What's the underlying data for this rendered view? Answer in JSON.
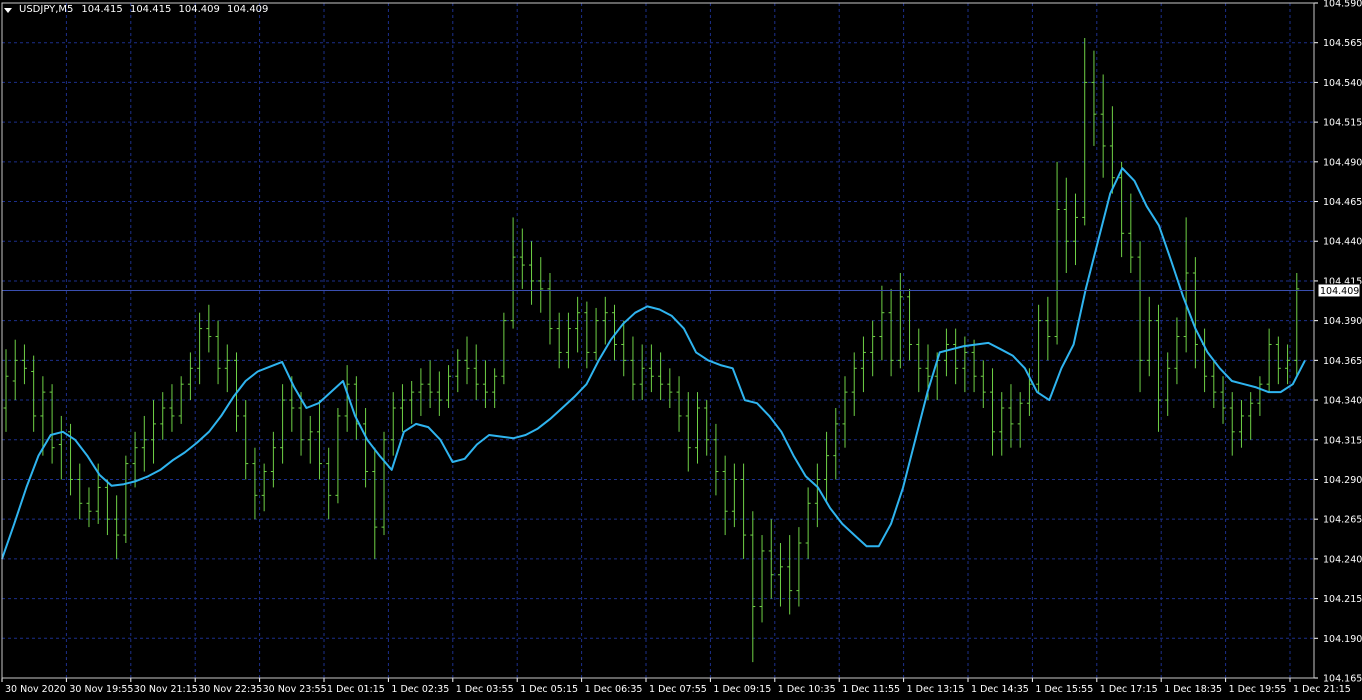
{
  "header": {
    "symbol_label": "USDJPY,M5",
    "ohlc": [
      "104.415",
      "104.415",
      "104.409",
      "104.409"
    ]
  },
  "colors": {
    "background": "#000000",
    "grid": "#1c2f8c",
    "bars": "#6fd146",
    "moving_average": "#2fb4ef",
    "axis_text": "#ffffff"
  },
  "chart_data": {
    "type": "line",
    "series": [
      {
        "name": "",
        "kind": "ohlc-bars",
        "values": [
          [
            104.335,
            104.372,
            104.32,
            104.355
          ],
          [
            104.352,
            104.378,
            104.34,
            104.365
          ],
          [
            104.365,
            104.375,
            104.35,
            104.36
          ],
          [
            104.358,
            104.368,
            104.32,
            104.33
          ],
          [
            104.33,
            104.355,
            104.305,
            104.345
          ],
          [
            104.345,
            104.35,
            104.3,
            104.31
          ],
          [
            104.312,
            104.33,
            104.29,
            104.32
          ],
          [
            104.32,
            104.325,
            104.28,
            104.29
          ],
          [
            104.29,
            104.3,
            104.265,
            104.275
          ],
          [
            104.275,
            104.285,
            104.26,
            104.27
          ],
          [
            104.27,
            104.3,
            104.262,
            104.285
          ],
          [
            104.285,
            104.29,
            104.255,
            104.265
          ],
          [
            104.265,
            104.28,
            104.24,
            104.255
          ],
          [
            104.255,
            104.305,
            104.25,
            104.3
          ],
          [
            104.3,
            104.32,
            104.285,
            104.31
          ],
          [
            104.31,
            104.33,
            104.295,
            104.315
          ],
          [
            104.315,
            104.34,
            104.3,
            104.325
          ],
          [
            104.325,
            104.345,
            104.315,
            104.335
          ],
          [
            104.335,
            104.35,
            104.32,
            104.33
          ],
          [
            104.33,
            104.355,
            104.325,
            104.35
          ],
          [
            104.35,
            104.37,
            104.34,
            104.36
          ],
          [
            104.36,
            104.395,
            104.35,
            104.385
          ],
          [
            104.385,
            104.4,
            104.37,
            104.38
          ],
          [
            104.38,
            104.39,
            104.35,
            104.36
          ],
          [
            104.36,
            104.375,
            104.345,
            104.365
          ],
          [
            104.365,
            104.37,
            104.32,
            104.33
          ],
          [
            104.33,
            104.34,
            104.29,
            104.3
          ],
          [
            104.3,
            104.31,
            104.265,
            104.28
          ],
          [
            104.28,
            104.3,
            104.27,
            104.295
          ],
          [
            104.295,
            104.32,
            104.285,
            104.31
          ],
          [
            104.31,
            104.35,
            104.3,
            104.34
          ],
          [
            104.34,
            104.355,
            104.32,
            104.335
          ],
          [
            104.335,
            104.345,
            104.305,
            104.315
          ],
          [
            104.315,
            104.33,
            104.3,
            104.32
          ],
          [
            104.32,
            104.34,
            104.29,
            104.3
          ],
          [
            104.3,
            104.31,
            104.265,
            104.28
          ],
          [
            104.28,
            104.335,
            104.275,
            104.33
          ],
          [
            104.33,
            104.362,
            104.32,
            104.35
          ],
          [
            104.35,
            104.355,
            104.315,
            104.325
          ],
          [
            104.325,
            104.335,
            104.285,
            104.295
          ],
          [
            104.295,
            104.31,
            104.24,
            104.26
          ],
          [
            104.26,
            104.32,
            104.255,
            104.315
          ],
          [
            104.315,
            104.345,
            104.305,
            104.335
          ],
          [
            104.335,
            104.35,
            104.32,
            104.34
          ],
          [
            104.34,
            104.352,
            104.325,
            104.345
          ],
          [
            104.345,
            104.36,
            104.33,
            104.35
          ],
          [
            104.35,
            104.365,
            104.335,
            104.345
          ],
          [
            104.345,
            104.358,
            104.33,
            104.34
          ],
          [
            104.34,
            104.362,
            104.335,
            104.355
          ],
          [
            104.355,
            104.372,
            104.345,
            104.365
          ],
          [
            104.365,
            104.38,
            104.35,
            104.36
          ],
          [
            104.36,
            104.375,
            104.34,
            104.35
          ],
          [
            104.35,
            104.365,
            104.335,
            104.345
          ],
          [
            104.345,
            104.36,
            104.335,
            104.355
          ],
          [
            104.355,
            104.395,
            104.35,
            104.39
          ],
          [
            104.39,
            104.455,
            104.385,
            104.43
          ],
          [
            104.43,
            104.448,
            104.41,
            104.425
          ],
          [
            104.425,
            104.44,
            104.4,
            104.415
          ],
          [
            104.415,
            104.43,
            104.395,
            104.41
          ],
          [
            104.41,
            104.42,
            104.375,
            104.385
          ],
          [
            104.385,
            104.395,
            104.36,
            104.37
          ],
          [
            104.37,
            104.395,
            104.36,
            104.385
          ],
          [
            104.385,
            104.405,
            104.37,
            104.395
          ],
          [
            104.395,
            104.402,
            104.36,
            104.37
          ],
          [
            104.37,
            104.398,
            104.365,
            104.39
          ],
          [
            104.39,
            104.405,
            104.375,
            104.395
          ],
          [
            104.395,
            104.4,
            104.365,
            104.375
          ],
          [
            104.375,
            104.39,
            104.355,
            104.365
          ],
          [
            104.365,
            104.38,
            104.34,
            104.35
          ],
          [
            104.35,
            104.375,
            104.34,
            104.36
          ],
          [
            104.36,
            104.375,
            104.345,
            104.355
          ],
          [
            104.355,
            104.37,
            104.34,
            104.35
          ],
          [
            104.35,
            104.36,
            104.335,
            104.345
          ],
          [
            104.345,
            104.355,
            104.32,
            104.33
          ],
          [
            104.33,
            104.345,
            104.295,
            104.31
          ],
          [
            104.31,
            104.345,
            104.3,
            104.335
          ],
          [
            104.335,
            104.34,
            104.305,
            104.315
          ],
          [
            104.315,
            104.325,
            104.28,
            104.295
          ],
          [
            104.295,
            104.305,
            104.255,
            104.27
          ],
          [
            104.27,
            104.3,
            104.26,
            104.29
          ],
          [
            104.29,
            104.3,
            104.24,
            104.255
          ],
          [
            104.255,
            104.27,
            104.175,
            104.21
          ],
          [
            104.21,
            104.255,
            104.2,
            104.245
          ],
          [
            104.245,
            104.265,
            104.215,
            104.23
          ],
          [
            104.23,
            104.25,
            104.21,
            104.235
          ],
          [
            104.235,
            104.255,
            104.205,
            104.22
          ],
          [
            104.22,
            104.26,
            104.21,
            104.25
          ],
          [
            104.25,
            104.285,
            104.24,
            104.275
          ],
          [
            104.275,
            104.3,
            104.26,
            104.29
          ],
          [
            104.29,
            104.32,
            104.275,
            104.305
          ],
          [
            104.305,
            104.335,
            104.29,
            104.325
          ],
          [
            104.325,
            104.355,
            104.31,
            104.345
          ],
          [
            104.345,
            104.37,
            104.33,
            104.36
          ],
          [
            104.36,
            104.38,
            104.345,
            104.37
          ],
          [
            104.37,
            104.39,
            104.355,
            104.38
          ],
          [
            104.38,
            104.412,
            104.365,
            104.395
          ],
          [
            104.395,
            104.41,
            104.355,
            104.365
          ],
          [
            104.365,
            104.42,
            104.36,
            104.405
          ],
          [
            104.405,
            104.41,
            104.365,
            104.375
          ],
          [
            104.375,
            104.385,
            104.345,
            104.36
          ],
          [
            104.36,
            104.375,
            104.34,
            104.355
          ],
          [
            104.355,
            104.37,
            104.34,
            104.365
          ],
          [
            104.365,
            104.385,
            104.355,
            104.375
          ],
          [
            104.375,
            104.385,
            104.35,
            104.36
          ],
          [
            104.36,
            104.38,
            104.345,
            104.37
          ],
          [
            104.37,
            104.378,
            104.345,
            104.355
          ],
          [
            104.355,
            104.365,
            104.335,
            104.345
          ],
          [
            104.345,
            104.36,
            104.305,
            104.32
          ],
          [
            104.32,
            104.345,
            104.305,
            104.335
          ],
          [
            104.335,
            104.35,
            104.31,
            104.325
          ],
          [
            104.325,
            104.345,
            104.31,
            104.338
          ],
          [
            104.338,
            104.36,
            104.33,
            104.35
          ],
          [
            104.35,
            104.4,
            104.345,
            104.39
          ],
          [
            104.39,
            104.405,
            104.365,
            104.38
          ],
          [
            104.38,
            104.49,
            104.375,
            104.46
          ],
          [
            104.46,
            104.48,
            104.42,
            104.44
          ],
          [
            104.44,
            104.47,
            104.425,
            104.455
          ],
          [
            104.455,
            104.568,
            104.45,
            104.54
          ],
          [
            104.54,
            104.56,
            104.5,
            104.52
          ],
          [
            104.52,
            104.545,
            104.48,
            104.5
          ],
          [
            104.5,
            104.525,
            104.47,
            104.48
          ],
          [
            104.48,
            104.49,
            104.43,
            104.445
          ],
          [
            104.445,
            104.47,
            104.42,
            104.43
          ],
          [
            104.43,
            104.44,
            104.345,
            104.365
          ],
          [
            104.365,
            104.405,
            104.355,
            104.39
          ],
          [
            104.39,
            104.4,
            104.32,
            104.34
          ],
          [
            104.34,
            104.37,
            104.33,
            104.36
          ],
          [
            104.36,
            104.392,
            104.35,
            104.38
          ],
          [
            104.38,
            104.455,
            104.37,
            104.42
          ],
          [
            104.42,
            104.43,
            104.36,
            104.375
          ],
          [
            104.375,
            104.385,
            104.345,
            104.355
          ],
          [
            104.355,
            104.365,
            104.335,
            104.345
          ],
          [
            104.345,
            104.355,
            104.325,
            104.335
          ],
          [
            104.335,
            104.345,
            104.305,
            104.32
          ],
          [
            104.32,
            104.34,
            104.31,
            104.33
          ],
          [
            104.33,
            104.345,
            104.315,
            104.338
          ],
          [
            104.338,
            104.355,
            104.33,
            104.35
          ],
          [
            104.35,
            104.385,
            104.345,
            104.375
          ],
          [
            104.375,
            104.38,
            104.35,
            104.36
          ],
          [
            104.36,
            104.375,
            104.35,
            104.365
          ],
          [
            104.365,
            104.42,
            104.355,
            104.41
          ]
        ]
      },
      {
        "name": "",
        "kind": "moving-average",
        "values": [
          104.24,
          104.262,
          104.285,
          104.305,
          104.318,
          104.32,
          104.315,
          104.305,
          104.293,
          104.286,
          104.287,
          104.289,
          104.292,
          104.296,
          104.302,
          104.307,
          104.313,
          104.32,
          104.33,
          104.342,
          104.352,
          104.358,
          104.361,
          104.364,
          104.348,
          104.335,
          104.338,
          104.345,
          104.352,
          104.33,
          104.315,
          104.305,
          104.296,
          104.32,
          104.325,
          104.323,
          104.315,
          104.301,
          104.303,
          104.312,
          104.318,
          104.317,
          104.316,
          104.318,
          104.322,
          104.328,
          104.335,
          104.342,
          104.35,
          104.365,
          104.378,
          104.388,
          104.395,
          104.399,
          104.397,
          104.393,
          104.385,
          104.37,
          104.365,
          104.362,
          104.36,
          104.34,
          104.338,
          104.33,
          104.32,
          104.305,
          104.292,
          104.285,
          104.272,
          104.262,
          104.255,
          104.248,
          104.248,
          104.262,
          104.285,
          104.315,
          104.345,
          104.37,
          104.372,
          104.374,
          104.375,
          104.376,
          104.372,
          104.368,
          104.36,
          104.345,
          104.34,
          104.36,
          104.375,
          104.41,
          104.44,
          104.47,
          104.486,
          104.478,
          104.462,
          104.45,
          104.428,
          104.405,
          104.385,
          104.37,
          104.36,
          104.352,
          104.35,
          104.348,
          104.345,
          104.345,
          104.35,
          104.365
        ]
      }
    ],
    "y_ticks": [
      "104.590",
      "104.565",
      "104.540",
      "104.515",
      "104.490",
      "104.465",
      "104.440",
      "104.415",
      "104.390",
      "104.365",
      "104.340",
      "104.315",
      "104.290",
      "104.265",
      "104.240",
      "104.215",
      "104.190",
      "104.165"
    ],
    "x_ticks": [
      "30 Nov 2020",
      "30 Nov 19:55",
      "30 Nov 21:15",
      "30 Nov 22:35",
      "30 Nov 23:55",
      "1 Dec 01:15",
      "1 Dec 02:35",
      "1 Dec 03:55",
      "1 Dec 05:15",
      "1 Dec 06:35",
      "1 Dec 07:55",
      "1 Dec 09:15",
      "1 Dec 10:35",
      "1 Dec 11:55",
      "1 Dec 13:15",
      "1 Dec 14:35",
      "1 Dec 15:55",
      "1 Dec 17:15",
      "1 Dec 18:35",
      "1 Dec 19:55",
      "1 Dec 21:15"
    ],
    "ylim": [
      104.165,
      104.59
    ],
    "current_price": 104.409,
    "current_price_label": "104.409",
    "grid": true
  }
}
